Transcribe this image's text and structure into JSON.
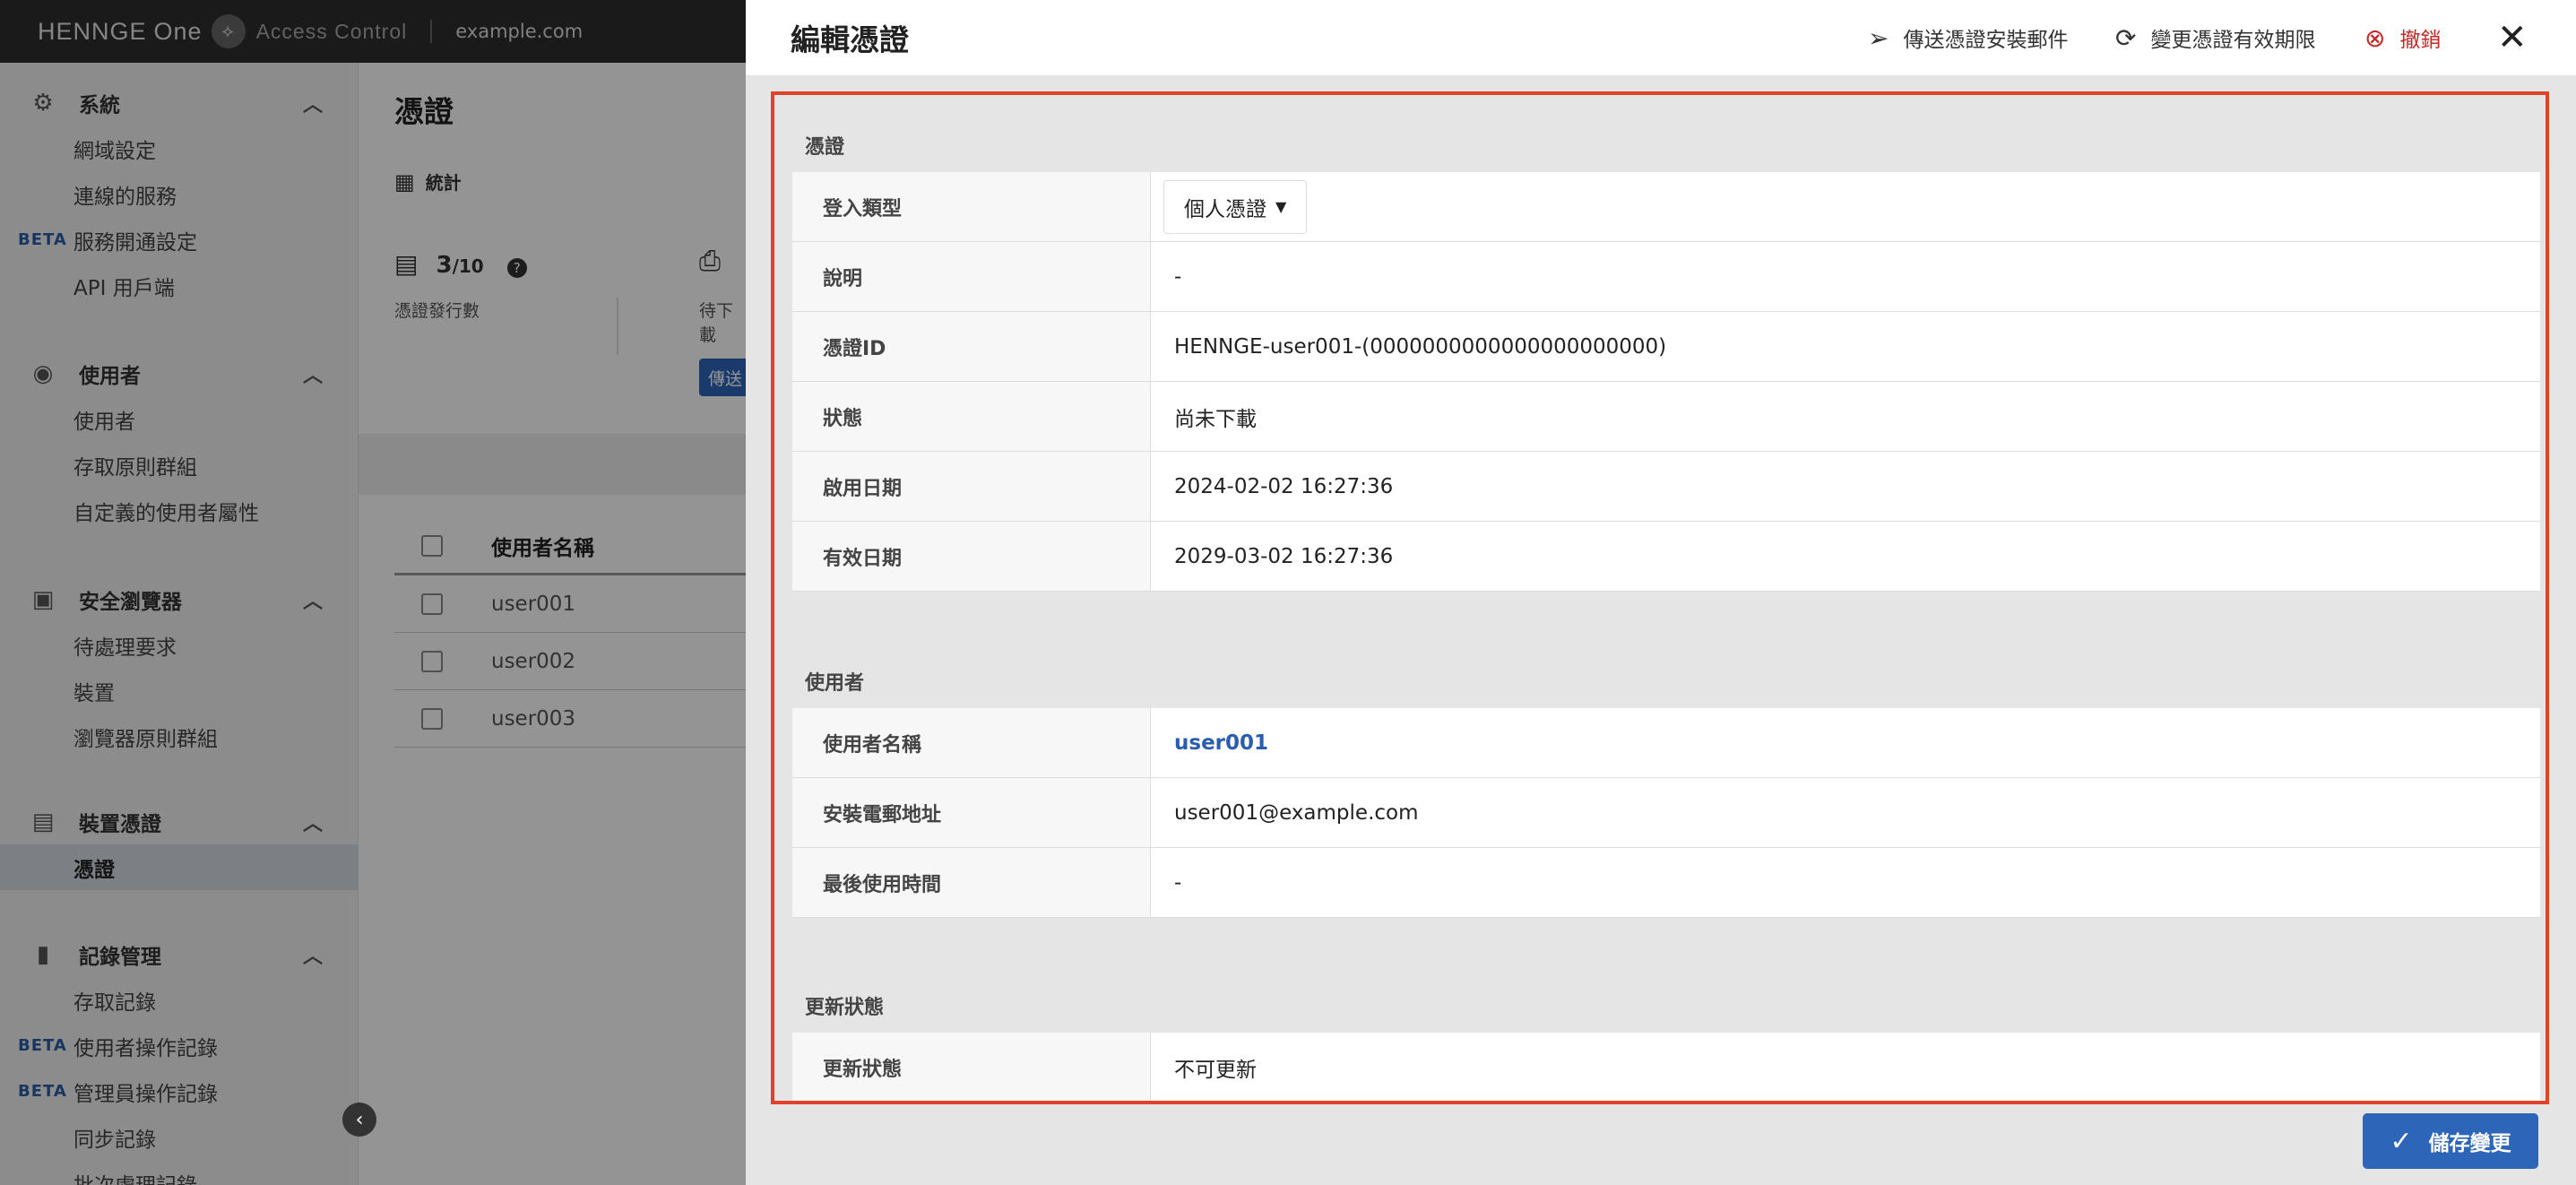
{
  "topbar": {
    "logo": "HENNGE",
    "logo_one": "One",
    "product": "Access Control",
    "domain": "example.com"
  },
  "sidebar": {
    "sections": [
      {
        "title": "系統",
        "icon": "gear-icon",
        "items": [
          {
            "label": "網域設定",
            "beta": ""
          },
          {
            "label": "連線的服務",
            "beta": ""
          },
          {
            "label": "服務開通設定",
            "beta": "BETA"
          },
          {
            "label": "API 用戶端",
            "beta": ""
          }
        ]
      },
      {
        "title": "使用者",
        "icon": "user-circle-icon",
        "items": [
          {
            "label": "使用者",
            "beta": ""
          },
          {
            "label": "存取原則群組",
            "beta": ""
          },
          {
            "label": "自定義的使用者屬性",
            "beta": ""
          }
        ]
      },
      {
        "title": "安全瀏覽器",
        "icon": "browser-icon",
        "items": [
          {
            "label": "待處理要求",
            "beta": ""
          },
          {
            "label": "裝置",
            "beta": ""
          },
          {
            "label": "瀏覽器原則群組",
            "beta": ""
          }
        ]
      },
      {
        "title": "裝置憑證",
        "icon": "id-card-icon",
        "items": [
          {
            "label": "憑證",
            "beta": "",
            "active": true
          }
        ]
      },
      {
        "title": "記錄管理",
        "icon": "bar-chart-icon",
        "items": [
          {
            "label": "存取記錄",
            "beta": ""
          },
          {
            "label": "使用者操作記錄",
            "beta": "BETA"
          },
          {
            "label": "管理員操作記錄",
            "beta": "BETA"
          },
          {
            "label": "同步記錄",
            "beta": ""
          },
          {
            "label": "批次處理記錄",
            "beta": ""
          }
        ]
      }
    ]
  },
  "main": {
    "title": "憑證",
    "stats_label": "統計",
    "stat_issued": "3",
    "stat_issued_total": "/10",
    "stat_issued_caption": "憑證發行數",
    "stat_pending_caption": "待下載",
    "send_button": "傳送",
    "table": {
      "header": "使用者名稱",
      "rows": [
        "user001",
        "user002",
        "user003"
      ]
    }
  },
  "drawer": {
    "title": "編輯憑證",
    "actions": {
      "send_mail": "傳送憑證安裝郵件",
      "change_validity": "變更憑證有效期限",
      "revoke": "撤銷"
    },
    "sections": {
      "certificate": {
        "title": "憑證",
        "login_type_label": "登入類型",
        "login_type_value": "個人憑證",
        "description_label": "說明",
        "description_value": "-",
        "cert_id_label": "憑證ID",
        "cert_id_value": "HENNGE-user001-(0000000000000000000000)",
        "status_label": "狀態",
        "status_value": "尚未下載",
        "enabled_label": "啟用日期",
        "enabled_value": "2024-02-02 16:27:36",
        "expiry_label": "有效日期",
        "expiry_value": "2029-03-02 16:27:36"
      },
      "user": {
        "title": "使用者",
        "username_label": "使用者名稱",
        "username_value": "user001",
        "email_label": "安裝電郵地址",
        "email_value": "user001@example.com",
        "last_used_label": "最後使用時間",
        "last_used_value": "-"
      },
      "renewal": {
        "title": "更新狀態",
        "status_label": "更新狀態",
        "status_value": "不可更新"
      }
    },
    "save_button": "儲存變更"
  },
  "colors": {
    "accent": "#2d65b8",
    "revoke": "#c62828",
    "highlight_border": "#e0412a",
    "topbar": "#2e2e2e"
  }
}
